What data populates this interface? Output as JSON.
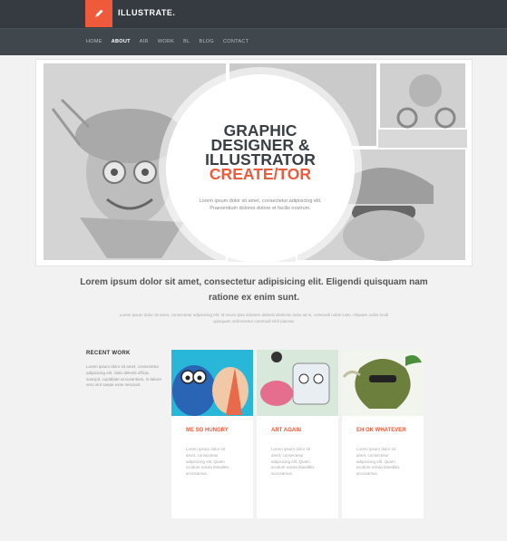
{
  "brand": {
    "name": "ILLUSTRATE.",
    "icon": "pencil-icon",
    "accent": "#ee5a3a"
  },
  "nav": [
    {
      "label": "HOME",
      "active": false
    },
    {
      "label": "ABOUT",
      "active": true
    },
    {
      "label": "AIR",
      "active": false
    },
    {
      "label": "WORK",
      "active": false
    },
    {
      "label": "BL",
      "active": false
    },
    {
      "label": "BLOG",
      "active": false
    },
    {
      "label": "CONTACT",
      "active": false
    }
  ],
  "hero": {
    "line1": "GRAPHIC",
    "line2": "DESIGNER &",
    "line3": "ILLUSTRATOR",
    "line4": "CREATE/TOR",
    "text": "Lorem ipsum dolor sit amet, consectetur adipisicing elit. Praesentium dolores dolore et facilis nostrum."
  },
  "intro": {
    "lead": "Lorem ipsum dolor sit amet, consectetur adipisicing elit. Eligendi quisquam nam ratione ex enim sunt.",
    "sub": "Lorem ipsum dolor sit amet, consectetur adipisicing elit. Id rerum ipsa dolorem deleniti distinctio iusto ad in, commodi nobis iusto. Aliquam nobis modi quisquam velit tenetur commodi nihil placeat."
  },
  "recent": {
    "title": "RECENT WORK",
    "text": "Lorem ipsum dolor sit amet, consectetur adipisicing elit. Odio deleniti officia, suscipit, cupiditate accusantium, in labore vero sint saepe esse nesciunt."
  },
  "cards": [
    {
      "title": "ME SO HUNGRY",
      "text": "Lorem ipsum dolor sit amet, consectetur adipisicing elit. Quam incidunt soluta blanditiis accusamus."
    },
    {
      "title": "ART AGAIN",
      "text": "Lorem ipsum dolor sit amet, consectetur adipisicing elit. Quam incidunt soluta blanditiis accusamus."
    },
    {
      "title": "EH OK WHATEVER",
      "text": "Lorem ipsum dolor sit amet, consectetur adipisicing elit. Quam incidunt soluta blanditiis accusamus."
    }
  ]
}
